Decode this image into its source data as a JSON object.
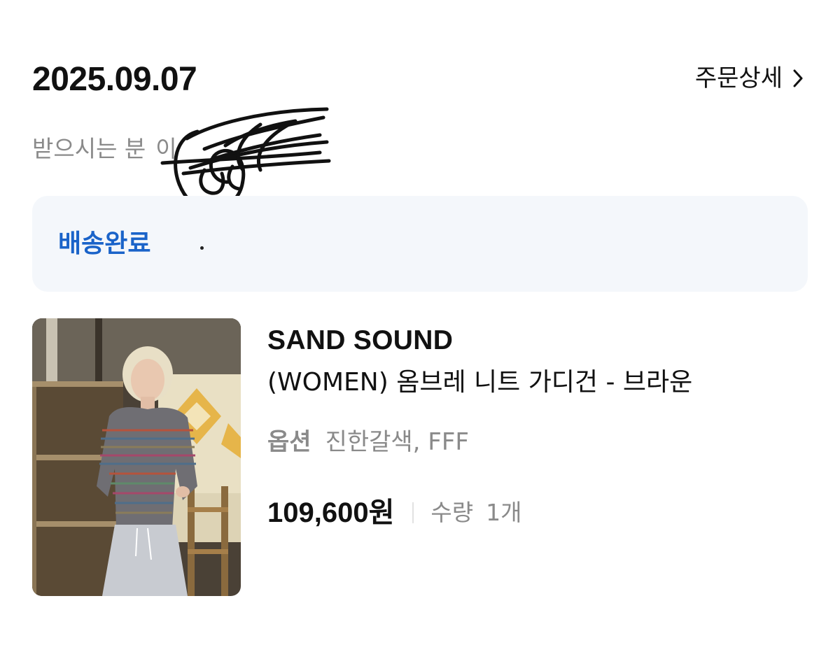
{
  "order": {
    "date": "2025.09.07",
    "detail_link_label": "주문상세",
    "recipient_label": "받으시는 분",
    "recipient_name": "이",
    "status": "배송완료"
  },
  "item": {
    "brand": "SAND SOUND",
    "name": "(WOMEN) 옴브레 니트 가디건 - 브라운",
    "option_label": "옵션",
    "option_value": "진한갈색, FFF",
    "price": "109,600원",
    "quantity_label": "수량",
    "quantity_value": "1개"
  },
  "icons": {
    "detail_chevron": "chevron-right-icon"
  },
  "colors": {
    "status_blue": "#1a63c9",
    "status_bg": "#f4f7fb",
    "muted_text": "#8a8a8a"
  }
}
